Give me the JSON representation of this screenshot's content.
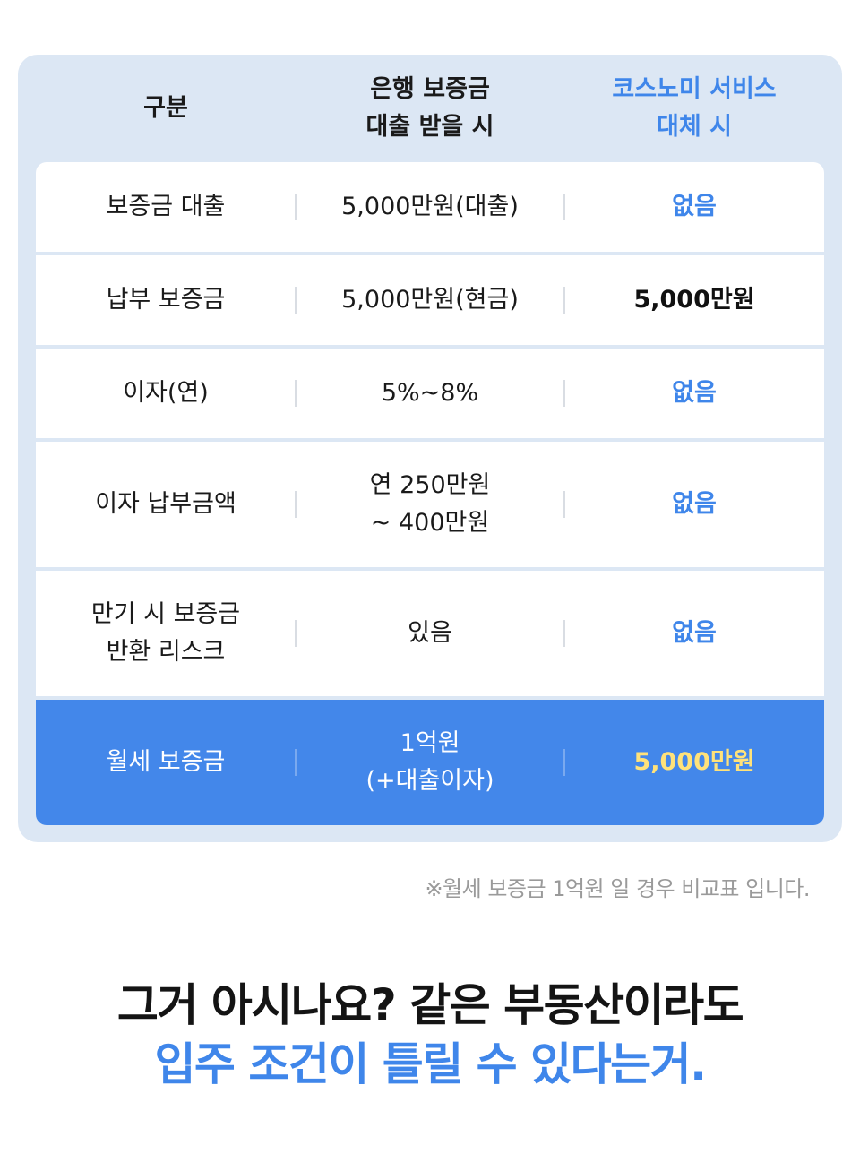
{
  "table": {
    "headers": [
      "구분",
      "은행 보증금\n대출 받을 시",
      "코스노미 서비스\n대체 시"
    ],
    "rows": [
      {
        "label": "보증금 대출",
        "bank": "5,000만원(대출)",
        "service": "없음"
      },
      {
        "label": "납부 보증금",
        "bank": "5,000만원(현금)",
        "service": "5,000만원"
      },
      {
        "label": "이자(연)",
        "bank": "5%~8%",
        "service": "없음"
      },
      {
        "label": "이자 납부금액",
        "bank": "연 250만원\n~ 400만원",
        "service": "없음"
      },
      {
        "label": "만기 시 보증금\n반환 리스크",
        "bank": "있음",
        "service": "없음"
      },
      {
        "label": "월세 보증금",
        "bank": "1억원\n(+대출이자)",
        "service": "5,000만원"
      }
    ]
  },
  "footnote": "※월세 보증금 1억원 일 경우 비교표 입니다.",
  "headline": {
    "line1": "그거 아시나요? 같은 부동산이라도",
    "line2": "입주 조건이 틀릴 수 있다는거."
  },
  "colors": {
    "accent": "#3f86ea",
    "panel": "#dce7f4",
    "highlight_row": "#4387ea",
    "highlight_value": "#ffe27a"
  }
}
